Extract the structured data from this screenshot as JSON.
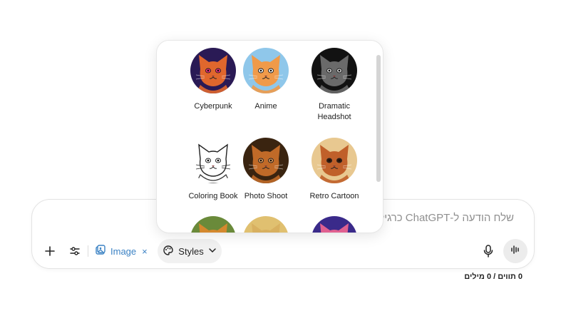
{
  "composer": {
    "placeholder": "שלח הודעה ל-ChatGPT כרגיל, או לחץ על הכפתור לרשימת פרומפטים",
    "image_chip_label": "Image",
    "image_chip_close": "×",
    "styles_label": "Styles",
    "plus_icon": "plus-icon",
    "tools_icon": "sliders-icon"
  },
  "counter": "0 תווים / 0 מילים",
  "styles_menu": {
    "items": [
      {
        "label": "Cyberpunk",
        "theme": {
          "bg": "#2a1a55",
          "cat": "#e0672d",
          "accent": "#ff2e88"
        }
      },
      {
        "label": "Anime",
        "theme": {
          "bg": "#8fc7ea",
          "cat": "#f09a49",
          "accent": "#ffffff"
        }
      },
      {
        "label": "Dramatic Headshot",
        "theme": {
          "bg": "#121212",
          "cat": "#6a6a6a",
          "accent": "#d6d6d6"
        }
      },
      {
        "label": "Coloring Book",
        "theme": {
          "bg": "#ffffff",
          "cat": "#ffffff",
          "accent": "#222222"
        }
      },
      {
        "label": "Photo Shoot",
        "theme": {
          "bg": "#3a2410",
          "cat": "#c06a28",
          "accent": "#e8a060"
        }
      },
      {
        "label": "Retro Cartoon",
        "theme": {
          "bg": "#e8c890",
          "cat": "#c0602a",
          "accent": "#3a1a0a"
        }
      },
      {
        "label": "",
        "theme": {
          "bg": "#6a8a3a",
          "cat": "#d4882e",
          "accent": "#f0c060"
        }
      },
      {
        "label": "",
        "theme": {
          "bg": "#e0c070",
          "cat": "#d8b060",
          "accent": "#f4e0a8"
        }
      },
      {
        "label": "",
        "theme": {
          "bg": "#3a2a8a",
          "cat": "#e06090",
          "accent": "#ff7a3a"
        }
      }
    ]
  }
}
